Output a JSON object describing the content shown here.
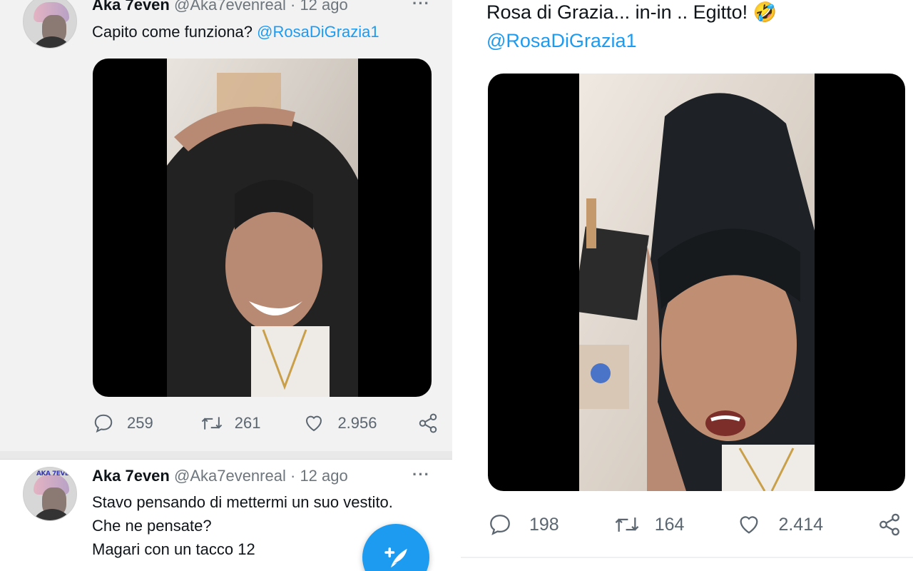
{
  "left": {
    "tweet1": {
      "name": "Aka 7even",
      "handle": "@Aka7evenreal",
      "dot": "·",
      "time": "12 ago",
      "more": "···",
      "text": "Capito come funziona?",
      "mention": "@RosaDiGrazia1",
      "replies": "259",
      "retweets": "261",
      "likes": "2.956"
    },
    "tweet2": {
      "avatar_text": "AKA 7EVEN",
      "name": "Aka 7even",
      "handle": "@Aka7evenreal",
      "dot": "·",
      "time": "12 ago",
      "more": "···",
      "lines": [
        "Stavo pensando di mettermi un suo vestito.",
        "Che ne pensate?",
        "Magari con un tacco 12"
      ]
    }
  },
  "right": {
    "text": "Rosa di Grazia... in-in .. Egitto!",
    "emoji": "🤣",
    "mention": "@RosaDiGrazia1",
    "replies": "198",
    "retweets": "164",
    "likes": "2.414"
  },
  "colors": {
    "accent": "#1d9bf0",
    "muted": "#6e767d",
    "text": "#0f1419"
  },
  "icons": [
    "reply-icon",
    "retweet-icon",
    "like-icon",
    "share-icon",
    "compose-icon"
  ]
}
